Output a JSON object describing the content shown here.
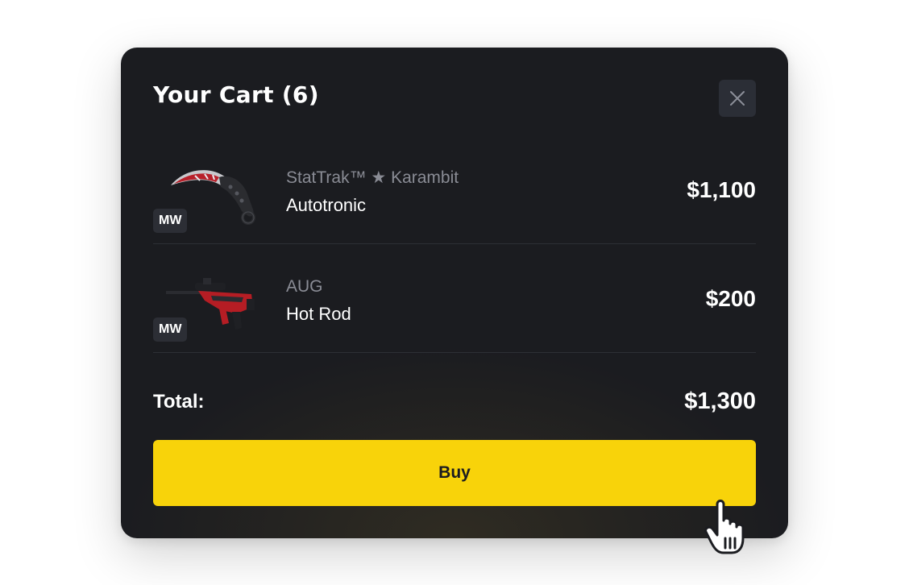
{
  "cart": {
    "title": "Your Cart (6)",
    "close_icon": "close-icon",
    "items": [
      {
        "type": "StatTrak™ ★ Karambit",
        "name": "Autotronic",
        "price": "$1,100",
        "wear": "MW",
        "image_icon": "karambit-knife-icon"
      },
      {
        "type": "AUG",
        "name": "Hot Rod",
        "price": "$200",
        "wear": "MW",
        "image_icon": "aug-rifle-icon"
      }
    ],
    "total_label": "Total:",
    "total_value": "$1,300",
    "buy_label": "Buy"
  },
  "cursor_icon": "hand-pointer-icon",
  "colors": {
    "panel": "#1b1c20",
    "accent": "#f8d30a",
    "badge": "#2c2e35",
    "muted_text": "#8a8c95"
  }
}
